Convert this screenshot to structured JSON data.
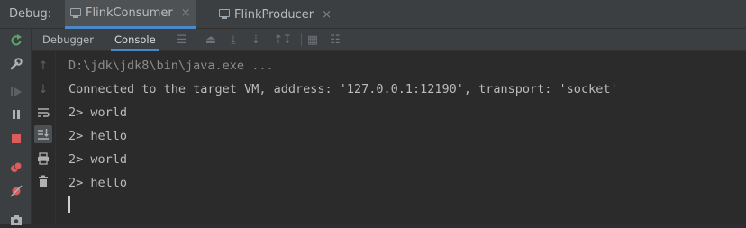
{
  "header": {
    "label": "Debug:",
    "tabs": [
      {
        "label": "FlinkConsumer",
        "active": true
      },
      {
        "label": "FlinkProducer",
        "active": false
      }
    ]
  },
  "sub_toolbar": {
    "tabs": [
      {
        "label": "Debugger",
        "active": false
      },
      {
        "label": "Console",
        "active": true
      }
    ]
  },
  "console": {
    "command": "D:\\jdk\\jdk8\\bin\\java.exe ...",
    "lines": [
      "Connected to the target VM, address: '127.0.0.1:12190', transport: 'socket'",
      "2> world",
      "2> hello",
      "2> world",
      "2> hello"
    ]
  },
  "colors": {
    "accent": "#4a88c7",
    "rerun_green": "#59a869",
    "stop_red": "#db5c5c"
  }
}
